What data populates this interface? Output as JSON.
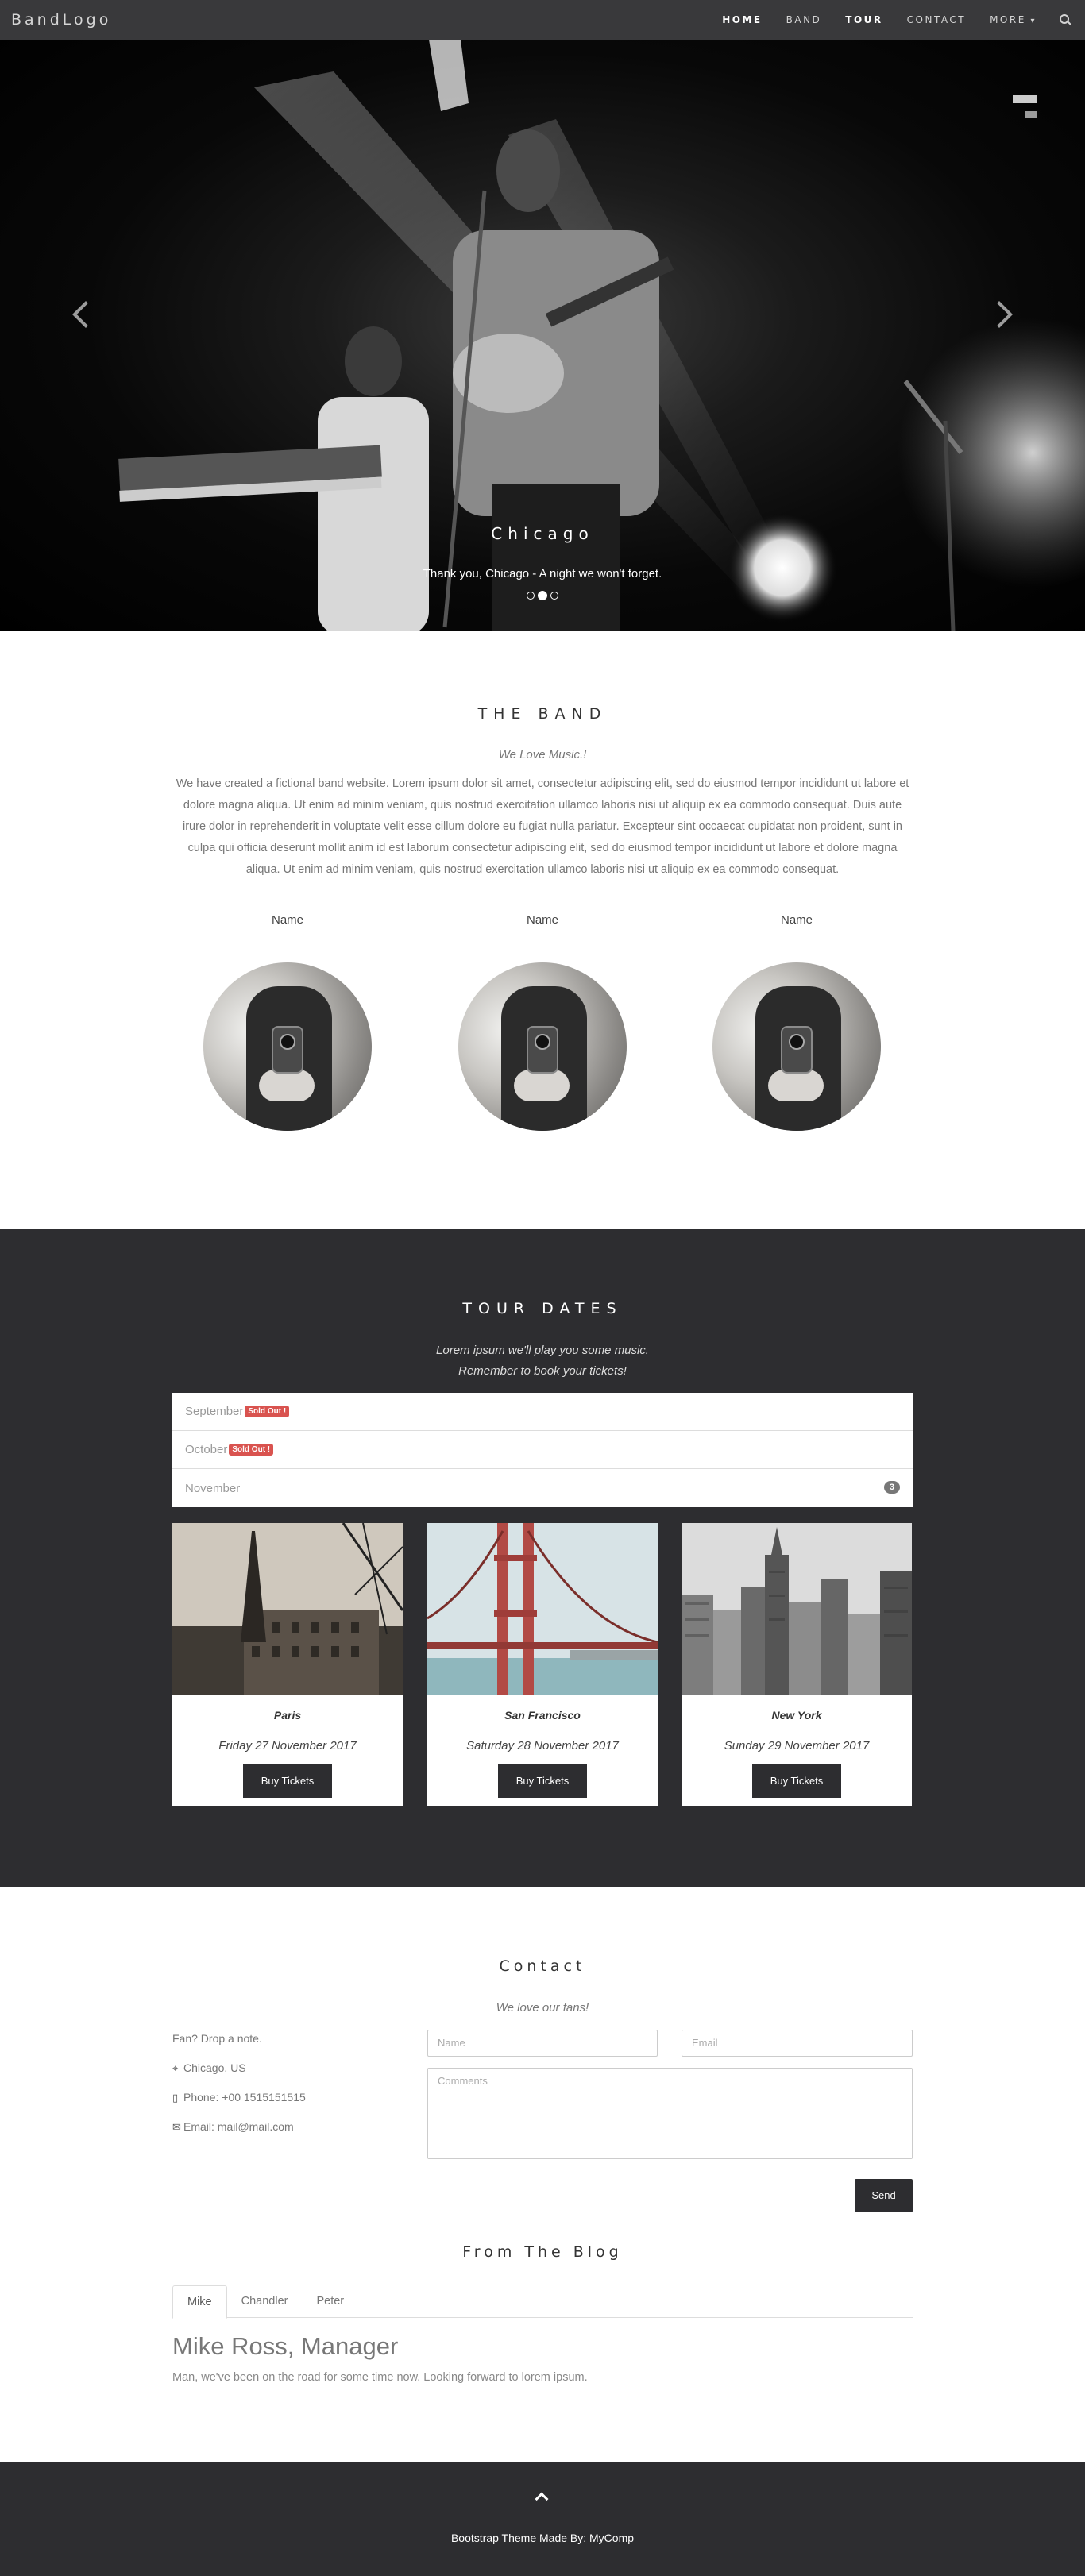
{
  "navbar": {
    "brand": "BandLogo",
    "links": [
      "HOME",
      "BAND",
      "TOUR",
      "CONTACT",
      "MORE"
    ]
  },
  "hero": {
    "city": "Chicago",
    "caption": "Thank you, Chicago - A night we won't forget.",
    "slide_count": 3,
    "active_slide": 2
  },
  "band": {
    "title": "THE BAND",
    "tagline": "We Love Music.!",
    "paragraph": "We have created a fictional band website. Lorem ipsum dolor sit amet, consectetur adipiscing elit, sed do eiusmod tempor incididunt ut labore et dolore magna aliqua. Ut enim ad minim veniam, quis nostrud exercitation ullamco laboris nisi ut aliquip ex ea commodo consequat. Duis aute irure dolor in reprehenderit in voluptate velit esse cillum dolore eu fugiat nulla pariatur. Excepteur sint occaecat cupidatat non proident, sunt in culpa qui officia deserunt mollit anim id est laborum consectetur adipiscing elit, sed do eiusmod tempor incididunt ut labore et dolore magna aliqua. Ut enim ad minim veniam, quis nostrud exercitation ullamco laboris nisi ut aliquip ex ea commodo consequat.",
    "members": [
      "Name",
      "Name",
      "Name"
    ]
  },
  "tour": {
    "title": "TOUR DATES",
    "lead_line1": "Lorem ipsum we'll play you some music.",
    "lead_line2": "Remember to book your tickets!",
    "months": [
      {
        "name": "September",
        "badge": "Sold Out !"
      },
      {
        "name": "October",
        "badge": "Sold Out !"
      },
      {
        "name": "November",
        "count": "3"
      }
    ],
    "cards": [
      {
        "city": "Paris",
        "date": "Friday 27 November 2017",
        "button": "Buy Tickets"
      },
      {
        "city": "San Francisco",
        "date": "Saturday 28 November 2017",
        "button": "Buy Tickets"
      },
      {
        "city": "New York",
        "date": "Sunday 29 November 2017",
        "button": "Buy Tickets"
      }
    ]
  },
  "contact": {
    "title": "Contact",
    "tagline": "We love our fans!",
    "note": "Fan? Drop a note.",
    "location": "Chicago, US",
    "phone": "Phone: +00 1515151515",
    "email": "Email: mail@mail.com",
    "name_placeholder": "Name",
    "email_placeholder": "Email",
    "comments_placeholder": "Comments",
    "send_label": "Send"
  },
  "blog": {
    "title": "From The Blog",
    "tabs": [
      "Mike",
      "Chandler",
      "Peter"
    ],
    "heading": "Mike Ross, Manager",
    "text": "Man, we've been on the road for some time now. Looking forward to lorem ipsum."
  },
  "footer": {
    "text": "Bootstrap Theme Made By: MyComp"
  }
}
